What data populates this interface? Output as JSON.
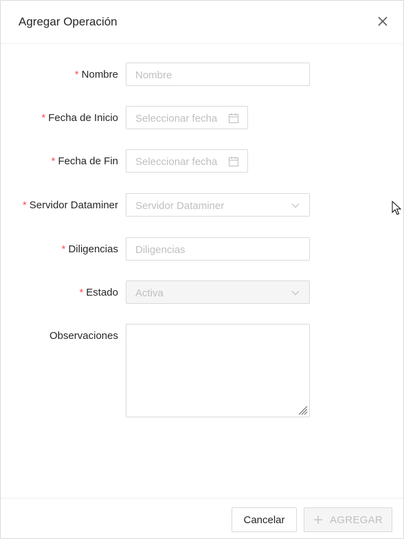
{
  "dialog": {
    "title": "Agregar Operación",
    "close_icon": "close-icon"
  },
  "form": {
    "required_marker": "*",
    "fields": {
      "nombre": {
        "label": "Nombre",
        "placeholder": "Nombre",
        "required": true
      },
      "fecha_inicio": {
        "label": "Fecha de Inicio",
        "placeholder": "Seleccionar fecha",
        "required": true,
        "icon": "calendar-icon"
      },
      "fecha_fin": {
        "label": "Fecha de Fin",
        "placeholder": "Seleccionar fecha",
        "required": true,
        "icon": "calendar-icon"
      },
      "servidor": {
        "label": "Servidor Dataminer",
        "placeholder": "Servidor Dataminer",
        "required": true,
        "icon": "chevron-down-icon"
      },
      "diligencias": {
        "label": "Diligencias",
        "placeholder": "Diligencias",
        "required": true
      },
      "estado": {
        "label": "Estado",
        "value": "Activa",
        "required": true,
        "disabled": true,
        "icon": "chevron-down-icon"
      },
      "observaciones": {
        "label": "Observaciones",
        "value": "",
        "required": false
      }
    }
  },
  "footer": {
    "cancel_label": "Cancelar",
    "add_label": "AGREGAR",
    "add_icon": "plus-icon",
    "add_disabled": true
  },
  "colors": {
    "required": "#ff4d4f",
    "border": "#d9d9d9",
    "placeholder": "#bfbfbf",
    "disabled_bg": "#f5f5f5",
    "text": "#262626"
  }
}
